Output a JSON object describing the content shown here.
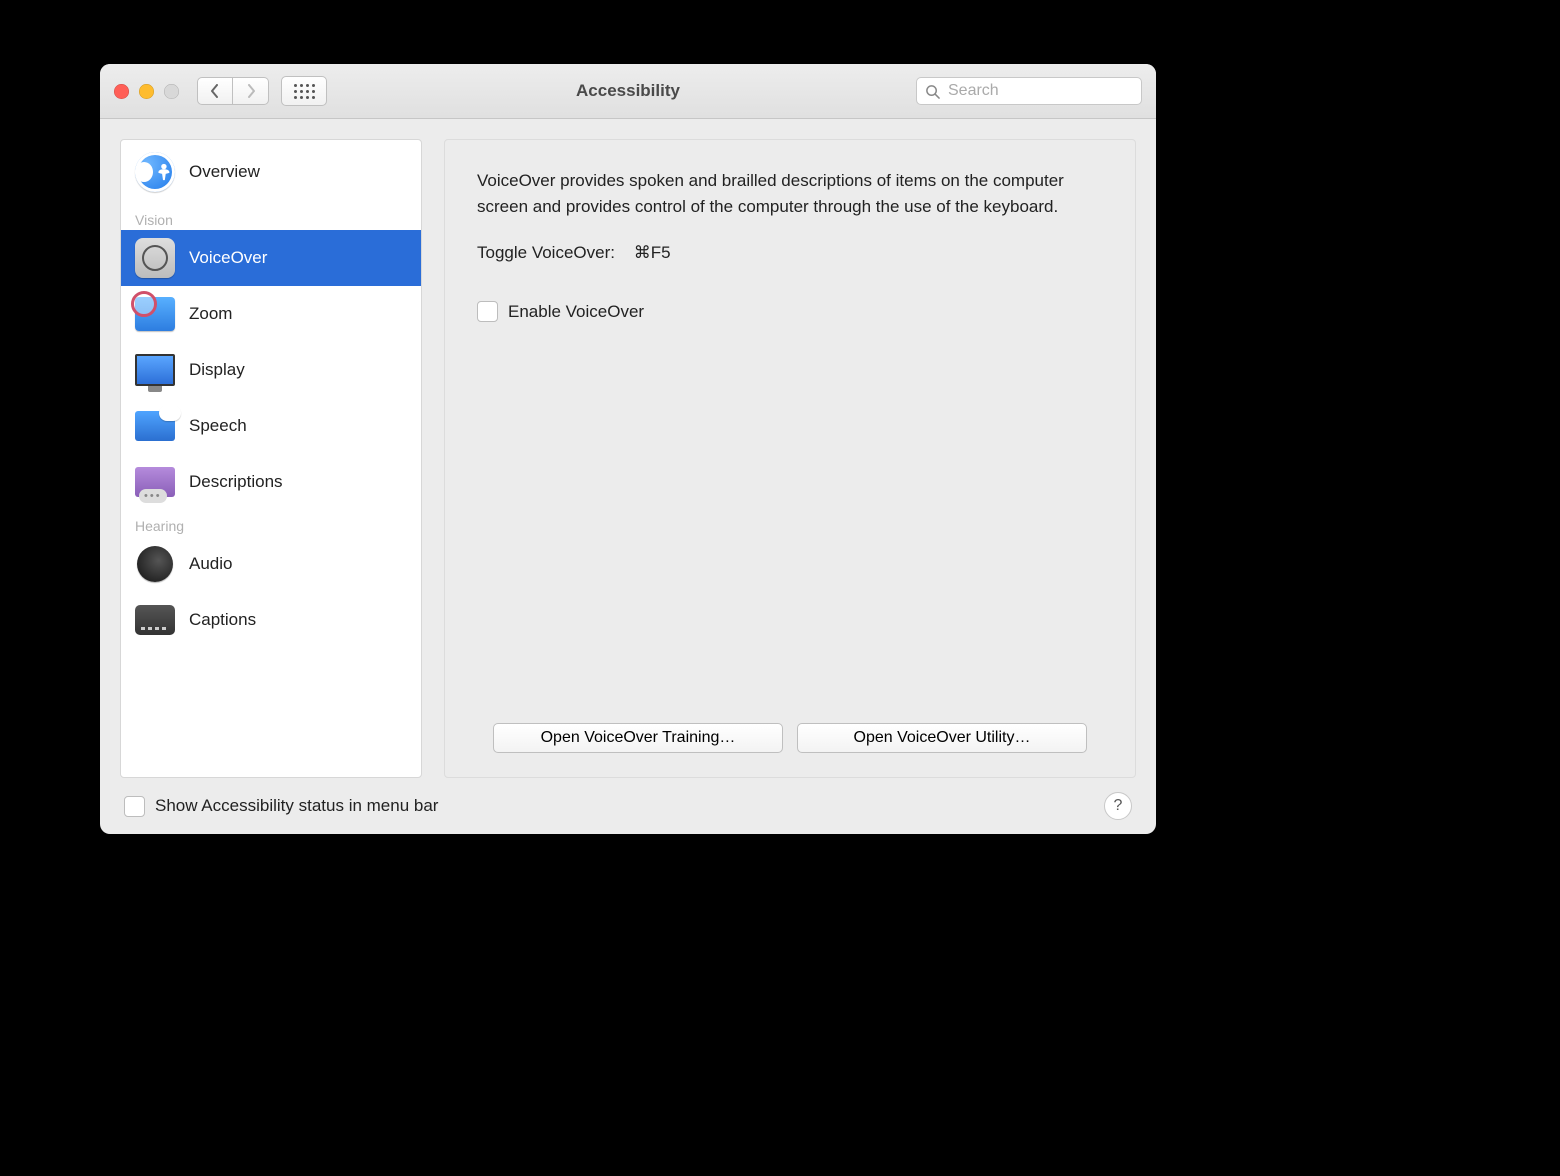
{
  "window": {
    "title": "Accessibility"
  },
  "search": {
    "placeholder": "Search",
    "value": ""
  },
  "sidebar": {
    "overview_label": "Overview",
    "groups": {
      "vision": "Vision",
      "hearing": "Hearing"
    },
    "items": {
      "voiceover": "VoiceOver",
      "zoom": "Zoom",
      "display": "Display",
      "speech": "Speech",
      "descriptions": "Descriptions",
      "audio": "Audio",
      "captions": "Captions"
    },
    "selected": "voiceover"
  },
  "panel": {
    "description": "VoiceOver provides spoken and brailled descriptions of items on the computer screen and provides control of the computer through the use of the keyboard.",
    "toggle_label": "Toggle VoiceOver:",
    "toggle_shortcut": "⌘F5",
    "enable_label": "Enable VoiceOver",
    "enable_checked": false,
    "button_training": "Open VoiceOver Training…",
    "button_utility": "Open VoiceOver Utility…"
  },
  "footer": {
    "status_label": "Show Accessibility status in menu bar",
    "status_checked": false,
    "help_label": "?"
  }
}
